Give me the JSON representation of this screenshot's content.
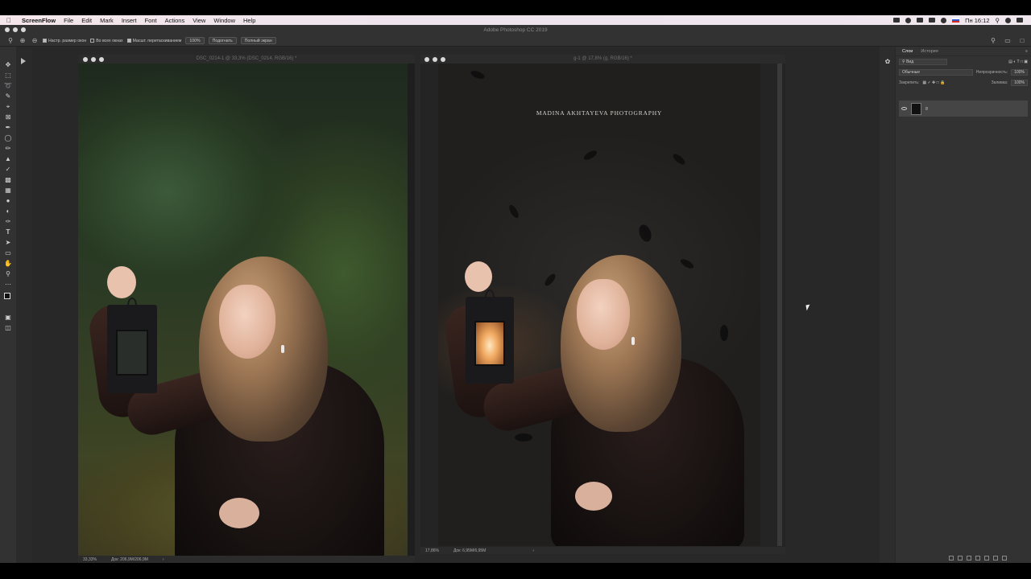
{
  "menubar": {
    "items": [
      "ScreenFlow",
      "File",
      "Edit",
      "Mark",
      "Insert",
      "Font",
      "Actions",
      "View",
      "Window",
      "Help"
    ],
    "clock": "Пн 16:12"
  },
  "app": {
    "title": "Adobe Photoshop CC 2019"
  },
  "options_bar": {
    "resize_windows": "Настр. размер окон",
    "all_windows": "Во всех окнах",
    "scrubby_zoom": "Масшт. перетаскиванием",
    "zoom_value": "100%",
    "fit_button": "Подогнать",
    "fill_button": "Полный экран"
  },
  "doc1": {
    "title": "DSC_0214-1 @ 33,3% (DSC_0214, RGB/16) *",
    "zoom": "33,33%",
    "doc_size": "Док: 206,9M/206,9M",
    "arrow": "›"
  },
  "doc2": {
    "title": "g-1 @ 17,8% (g, RGB/16) *",
    "caption": "MADINA AKHTAYEVA PHOTOGRAPHY",
    "zoom": "17,86%",
    "doc_size": "Док: 6,95M/6,95M",
    "arrow": "›"
  },
  "layers_panel": {
    "tabs": [
      "Слои",
      "История"
    ],
    "filter_kind": "Вид",
    "blend_mode": "Обычные",
    "opacity_label": "Непрозрачность:",
    "opacity_value": "100%",
    "lock_label": "Закрепить:",
    "fill_label": "Заливка:",
    "fill_value": "100%",
    "layer_name": "g"
  }
}
